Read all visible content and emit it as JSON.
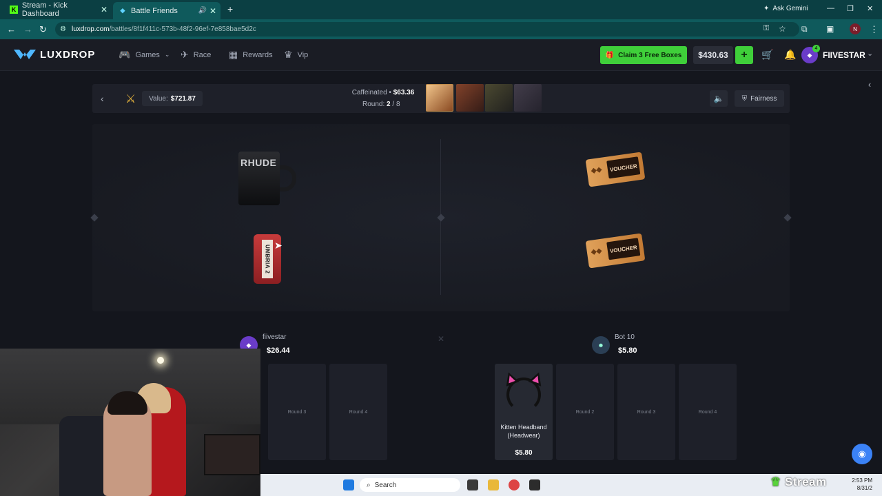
{
  "browser": {
    "tabs": [
      {
        "title": "Stream - Kick Dashboard",
        "favicon": "K"
      },
      {
        "title": "Battle Friends",
        "favicon": "L"
      }
    ],
    "ask_gemini": "Ask Gemini",
    "url_host": "luxdrop.com",
    "url_path": "/battles/8f1f411c-573b-48f2-96ef-7e858bae5d2c",
    "profile_initial": "N"
  },
  "site": {
    "logo": "LUXDROP",
    "nav": [
      {
        "label": "Games",
        "icon": "gamepad-icon"
      },
      {
        "label": "Race",
        "icon": "race-icon"
      },
      {
        "label": "Rewards",
        "icon": "gift-icon"
      },
      {
        "label": "Vip",
        "icon": "crown-icon"
      }
    ],
    "claim_label": "Claim 3 Free Boxes",
    "balance": "$430.63",
    "plus": "+",
    "username": "FIIVESTAR",
    "avatar_level": "4"
  },
  "battle": {
    "value_label": "Value:",
    "value": "$721.87",
    "case_name": "Caffeinated",
    "case_price": "$63.36",
    "round_label": "Round:",
    "round_current": "2",
    "round_total": "8",
    "fairness": "Fairness"
  },
  "reels": {
    "left_items": [
      {
        "name": "RHUDE"
      },
      {
        "name": "UMBRIA 2"
      }
    ],
    "right_items": [
      {
        "name": "VOUCHER"
      },
      {
        "name": "VOUCHER"
      }
    ]
  },
  "players": [
    {
      "name": "fiivestar",
      "balance": "$26.44",
      "slots": [
        "Round 3",
        "Round 4"
      ]
    },
    {
      "name": "Bot 10",
      "balance": "$5.80",
      "won_item": {
        "name_line1": "Kitten Headband",
        "name_line2": "(Headwear)",
        "value": "$5.80"
      },
      "slots": [
        "Round 2",
        "Round 3",
        "Round 4"
      ]
    }
  ],
  "taskbar": {
    "search_placeholder": "Search",
    "time": "2:53 PM",
    "date": "8/31/2"
  },
  "overlay": {
    "stream_logo": "Stream"
  },
  "colors": {
    "accent_green": "#3fcf3a",
    "chrome_teal": "#0f5a5c",
    "bg": "#14161d"
  }
}
